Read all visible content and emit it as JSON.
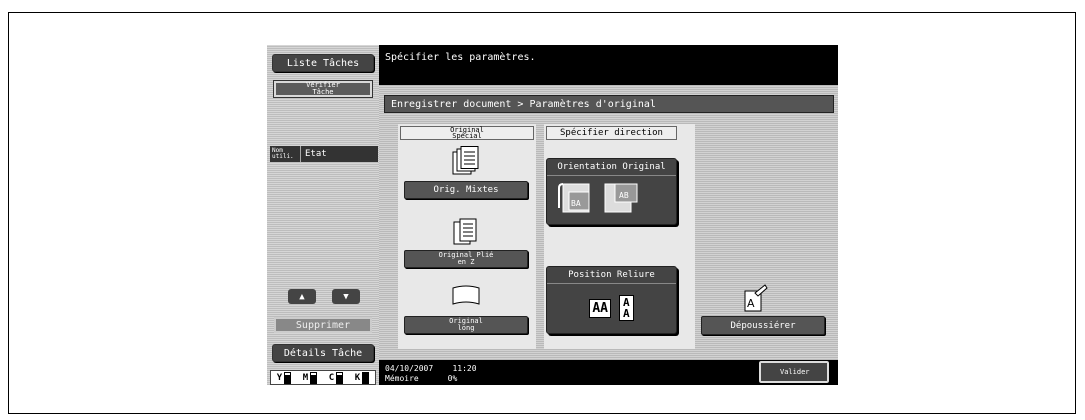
{
  "left": {
    "liste_taches": "Liste Tâches",
    "verifier_tache": "Vérifier Tâche",
    "col_nom": "Nom utili.",
    "col_etat": "Etat",
    "arrow_up": "▲",
    "arrow_down": "▼",
    "supprimer": "Supprimer",
    "details_tache": "Détails Tâche",
    "toner": [
      {
        "letter": "Y",
        "level": "high"
      },
      {
        "letter": "M",
        "level": "high"
      },
      {
        "letter": "C",
        "level": "high"
      },
      {
        "letter": "K",
        "level": "full"
      }
    ]
  },
  "message": "Spécifier les paramètres.",
  "breadcrumb": "Enregistrer document > Paramètres d'original",
  "original_special": {
    "tab": "Original Spécial",
    "mixtes": "Orig. Mixtes",
    "pli_en_z": "Original Plié en Z",
    "long": "Original long"
  },
  "direction": {
    "tab": "Spécifier direction",
    "orientation": "Orientation Original",
    "reliure": "Position Reliure",
    "reliure_letters_a": "AA",
    "reliure_letters_b": "A",
    "reliure_letters_c": "A"
  },
  "depoussierer": "Dépoussiérer",
  "status": {
    "date": "04/10/2007",
    "time": "11:20",
    "memoire": "Mémoire",
    "percent": "0%"
  },
  "valider": "Valider"
}
